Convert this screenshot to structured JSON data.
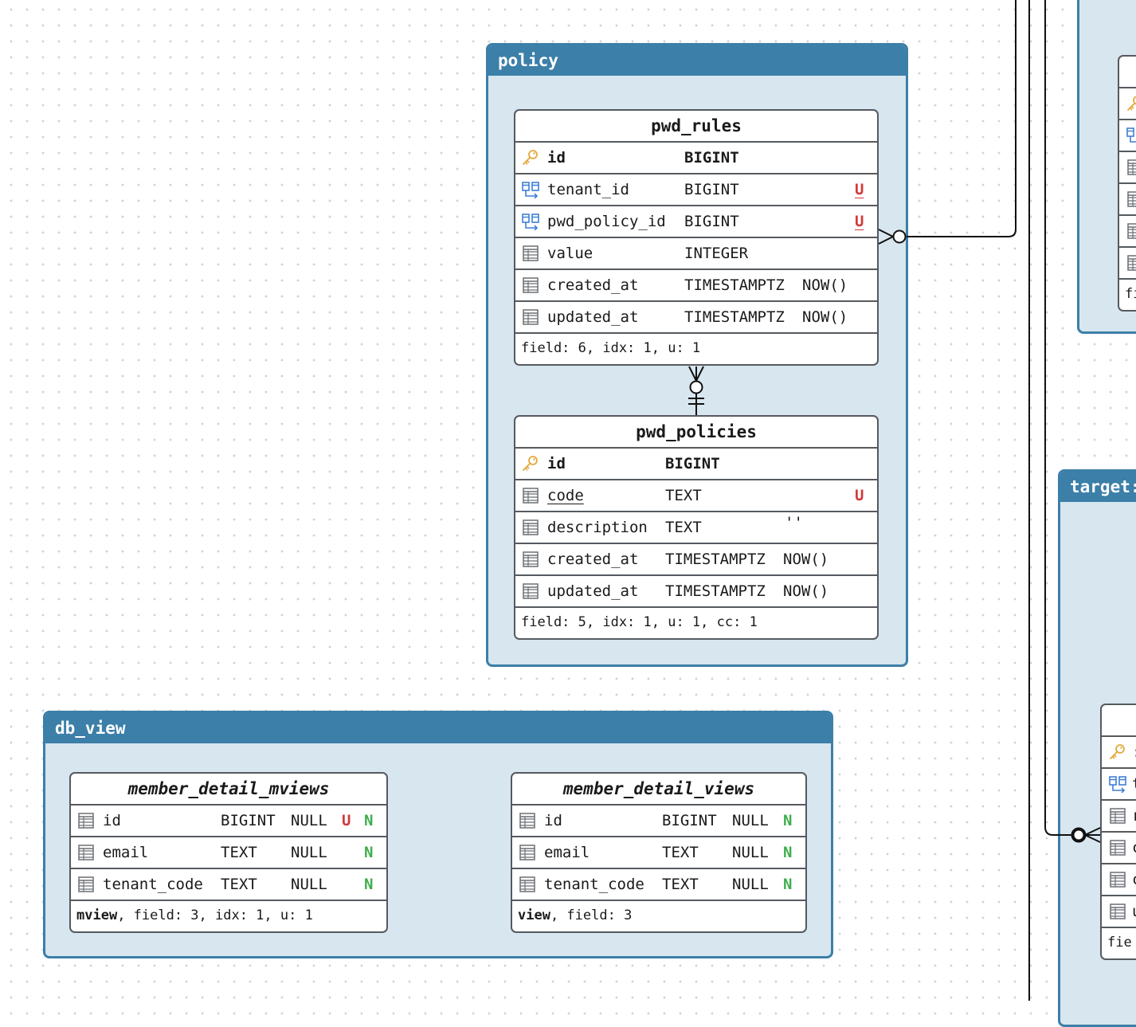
{
  "groups": {
    "policy": "policy",
    "db_view": "db_view",
    "target": "target:"
  },
  "pwd_rules": {
    "title": "pwd_rules",
    "rows": [
      {
        "name": "id",
        "type": "BIGINT",
        "default": "",
        "flag": ""
      },
      {
        "name": "tenant_id",
        "type": "BIGINT",
        "default": "",
        "flag": "U"
      },
      {
        "name": "pwd_policy_id",
        "type": "BIGINT",
        "default": "",
        "flag": "U"
      },
      {
        "name": "value",
        "type": "INTEGER",
        "default": "",
        "flag": ""
      },
      {
        "name": "created_at",
        "type": "TIMESTAMPTZ",
        "default": "NOW()",
        "flag": ""
      },
      {
        "name": "updated_at",
        "type": "TIMESTAMPTZ",
        "default": "NOW()",
        "flag": ""
      }
    ],
    "footer": "field: 6, idx: 1, u: 1"
  },
  "pwd_policies": {
    "title": "pwd_policies",
    "rows": [
      {
        "name": "id",
        "type": "BIGINT",
        "default": "",
        "flag": ""
      },
      {
        "name": "code",
        "type": "TEXT",
        "default": "",
        "flag": "U"
      },
      {
        "name": "description",
        "type": "TEXT",
        "default": "''",
        "flag": ""
      },
      {
        "name": "created_at",
        "type": "TIMESTAMPTZ",
        "default": "NOW()",
        "flag": ""
      },
      {
        "name": "updated_at",
        "type": "TIMESTAMPTZ",
        "default": "NOW()",
        "flag": ""
      }
    ],
    "footer": "field: 5, idx: 1, u: 1, cc: 1"
  },
  "member_detail_mviews": {
    "title": "member_detail_mviews",
    "rows": [
      {
        "name": "id",
        "type": "BIGINT",
        "null": "NULL",
        "u": "U",
        "n": "N"
      },
      {
        "name": "email",
        "type": "TEXT",
        "null": "NULL",
        "u": "",
        "n": "N"
      },
      {
        "name": "tenant_code",
        "type": "TEXT",
        "null": "NULL",
        "u": "",
        "n": "N"
      }
    ],
    "footer_kind": "mview",
    "footer_rest": ", field: 3, idx: 1, u: 1"
  },
  "member_detail_views": {
    "title": "member_detail_views",
    "rows": [
      {
        "name": "id",
        "type": "BIGINT",
        "null": "NULL",
        "n": "N"
      },
      {
        "name": "email",
        "type": "TEXT",
        "null": "NULL",
        "n": "N"
      },
      {
        "name": "tenant_code",
        "type": "TEXT",
        "null": "NULL",
        "n": "N"
      }
    ],
    "footer_kind": "view",
    "footer_rest": ", field: 3"
  },
  "right_top_table": {
    "footer": "fi"
  },
  "right_bottom_table": {
    "row_glyphs": [
      ":",
      "t",
      "r",
      "c",
      "c",
      "u"
    ],
    "footer": "fie"
  },
  "icons": {
    "primary_key": "key-icon",
    "foreign_key": "foreign-key-icon",
    "column": "column-icon"
  },
  "colors": {
    "group_border": "#3c7fa8",
    "group_fill": "#d7e6ef",
    "unique_flag": "#d03a3a",
    "nullable_flag": "#3fae4f",
    "pk_icon": "#e2a93b",
    "fk_icon": "#3f7fd6"
  }
}
